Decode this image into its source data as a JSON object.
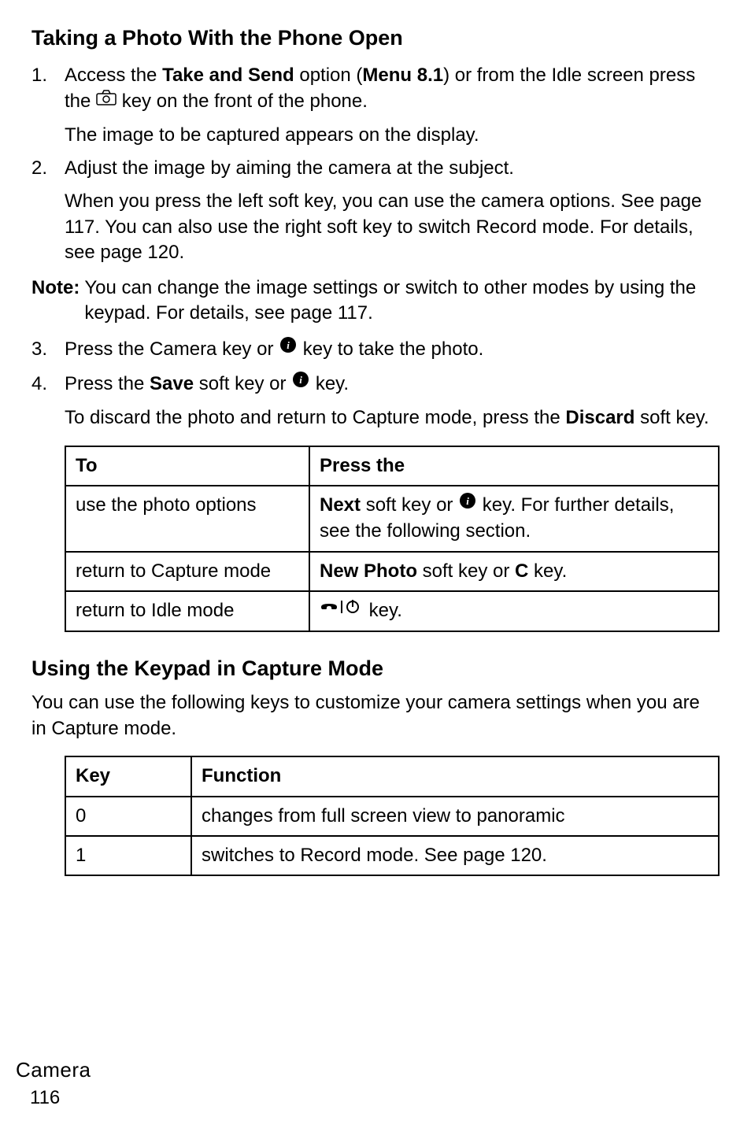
{
  "heading1": "Taking a Photo With the Phone Open",
  "step1_num": "1.",
  "step1_pre": "Access the ",
  "step1_bold1": "Take and Send",
  "step1_mid": " option (",
  "step1_bold2": "Menu 8.1",
  "step1_post": ") or from the Idle screen press the ",
  "step1_tail": " key on the front of the phone.",
  "step1_sub": "The image to be captured appears on the display.",
  "step2_num": "2.",
  "step2_text": "Adjust the image by aiming the camera at the subject.",
  "step2_sub": "When you press the left soft key, you can use the camera options. See page 117. You can also use the right soft key to switch Record mode. For details, see page 120.",
  "note_label": "Note:",
  "note_body": "You can change the image settings or switch to other modes by using the keypad. For details, see page 117.",
  "step3_num": "3.",
  "step3_pre": "Press the Camera key or ",
  "step3_post": " key to take the photo.",
  "step4_num": "4.",
  "step4_pre": "Press the ",
  "step4_bold": "Save",
  "step4_mid": " soft key or ",
  "step4_post": " key.",
  "step4_sub_pre": "To discard the photo and return to Capture mode, press the ",
  "step4_sub_bold": "Discard",
  "step4_sub_post": " soft key.",
  "table1": {
    "h1": "To",
    "h2": "Press the",
    "r1c1": "use the photo options",
    "r1c2_bold": "Next",
    "r1c2_mid": " soft key or ",
    "r1c2_post": " key. For further details, see the following section.",
    "r2c1": "return to Capture mode",
    "r2c2_bold1": "New Photo",
    "r2c2_mid": " soft key or ",
    "r2c2_bold2": "C",
    "r2c2_post": " key.",
    "r3c1": "return to Idle mode",
    "r3c2_post": " key."
  },
  "heading2": "Using the Keypad in Capture Mode",
  "body2": "You can use the following keys to customize your camera settings when you are in Capture mode.",
  "table2": {
    "h1": "Key",
    "h2": "Function",
    "r1c1": "0",
    "r1c2": "changes from full screen view to panoramic",
    "r2c1": "1",
    "r2c2": "switches to Record mode. See page 120."
  },
  "footer_section": "Camera",
  "footer_page": "116"
}
